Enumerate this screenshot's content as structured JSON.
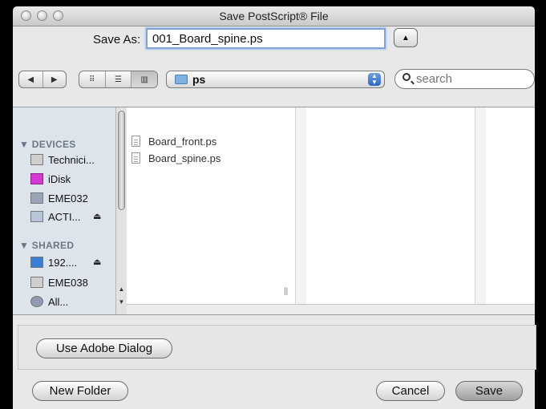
{
  "window": {
    "title": "Save PostScript® File"
  },
  "save_as": {
    "label": "Save As:",
    "value": "001_Board_spine.ps"
  },
  "toolbar": {
    "back_glyph": "◀",
    "forward_glyph": "▶",
    "view_icons": "⠿",
    "view_list": "☰",
    "view_columns": "▥",
    "location": "ps",
    "search_placeholder": "search"
  },
  "sidebar": {
    "devices_header": "▼ DEVICES",
    "devices": [
      {
        "label": "Technici...",
        "icon": "hard-drive-icon"
      },
      {
        "label": "iDisk",
        "icon": "idisk-icon"
      },
      {
        "label": "EME032",
        "icon": "computer-icon"
      },
      {
        "label": "ACTI...",
        "icon": "network-drive-icon",
        "eject": "⏏"
      }
    ],
    "shared_header": "▼ SHARED",
    "shared": [
      {
        "label": "192....",
        "icon": "monitor-icon",
        "eject": "⏏"
      },
      {
        "label": "EME038",
        "icon": "server-icon"
      },
      {
        "label": "All...",
        "icon": "network-globe-icon"
      }
    ]
  },
  "files": [
    {
      "name": "Board_front.ps"
    },
    {
      "name": "Board_spine.ps"
    }
  ],
  "buttons": {
    "use_adobe_dialog": "Use Adobe Dialog",
    "new_folder": "New Folder",
    "cancel": "Cancel",
    "save": "Save"
  },
  "colors": {
    "accent": "#2d66c6",
    "sidebar_bg": "#dde4ec",
    "focus_ring": "#7fa3d4"
  }
}
